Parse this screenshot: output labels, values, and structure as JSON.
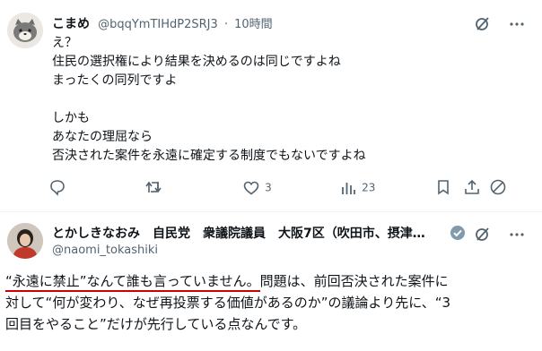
{
  "tweet1": {
    "author_name": "こまめ",
    "handle": "@bqqYmTIHdP2SRJ3",
    "separator": "·",
    "time": "10時間",
    "lines": [
      "え？",
      "住民の選択権により結果を決めるのは同じですよね",
      "まったくの同列ですよ",
      "",
      "しかも",
      "あなたの理屈なら",
      "否決された案件を永遠に確定する制度でもないですよね"
    ],
    "actions": {
      "reply_count": "",
      "retweet_count": "",
      "like_count": "3",
      "views_count": "23"
    }
  },
  "tweet2": {
    "author_name": "とかしきなおみ　自民党　衆議院議員　大阪7区（吹田市、摂津…",
    "handle": "@naomi_tokashiki",
    "text_underlined": "“永遠に禁止”なんて誰も言っていません。",
    "text_rest_line1": "問題は、前回否決された案件に",
    "line2": "対して“何が変わり、なぜ再投票する価値があるのか”の議論より先に、“3",
    "line3": "回目をやること”だけが先行している点なんです。",
    "underline_color": "#cc0000"
  },
  "colors": {
    "muted": "#536471",
    "verified": "#829aab",
    "grok": "#536471"
  }
}
